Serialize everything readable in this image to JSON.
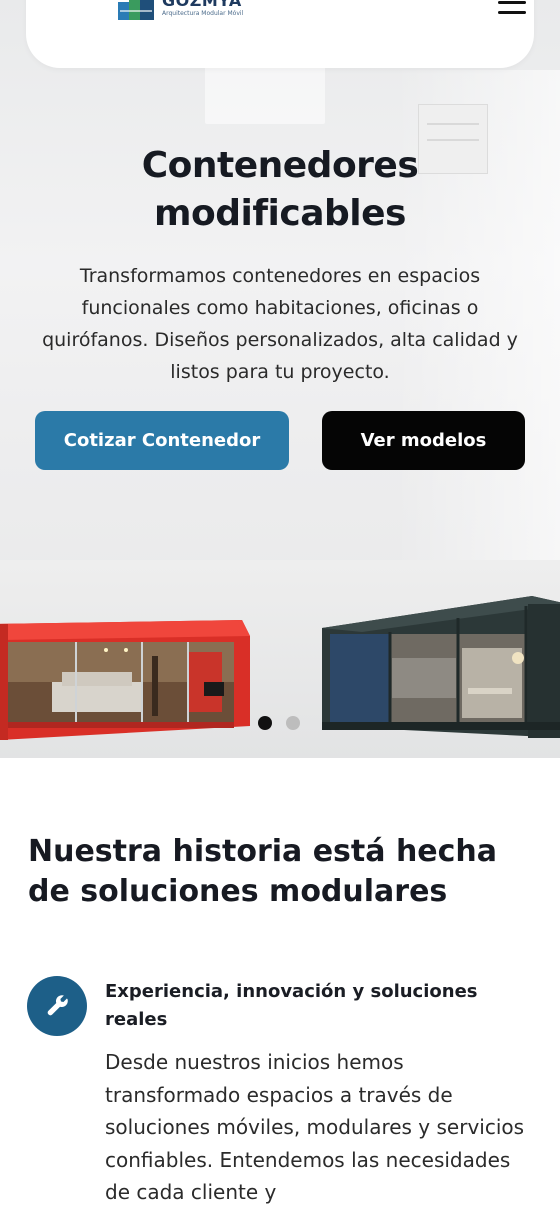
{
  "header": {
    "brand_name": "GOZMYA",
    "brand_tagline": "Arquitectura Modular Móvil",
    "menu_icon": "hamburger-menu-icon"
  },
  "hero": {
    "title_line1": "Contenedores",
    "title_line2": "modificables",
    "subtitle": "Transformamos contenedores en espacios funcionales como habitaciones, oficinas o quirófanos. Diseños personalizados, alta calidad y listos para tu proyecto.",
    "primary_button": "Cotizar Contenedor",
    "secondary_button": "Ver modelos",
    "carousel": {
      "total_slides": 2,
      "active_slide": 1
    }
  },
  "story": {
    "title": "Nuestra historia está hecha de soluciones modulares",
    "feature": {
      "icon": "wrench-icon",
      "heading": "Experiencia, innovación y soluciones reales",
      "body": "Desde nuestros inicios hemos transformado espacios a través de soluciones móviles, modulares y servicios confiables. Entendemos las necesidades de cada cliente y"
    }
  },
  "colors": {
    "primary": "#2b7aa8",
    "dark_button": "#050505",
    "icon_circle": "#1d5f88",
    "container_red": "#e53935",
    "container_dark": "#2f3a3a"
  }
}
